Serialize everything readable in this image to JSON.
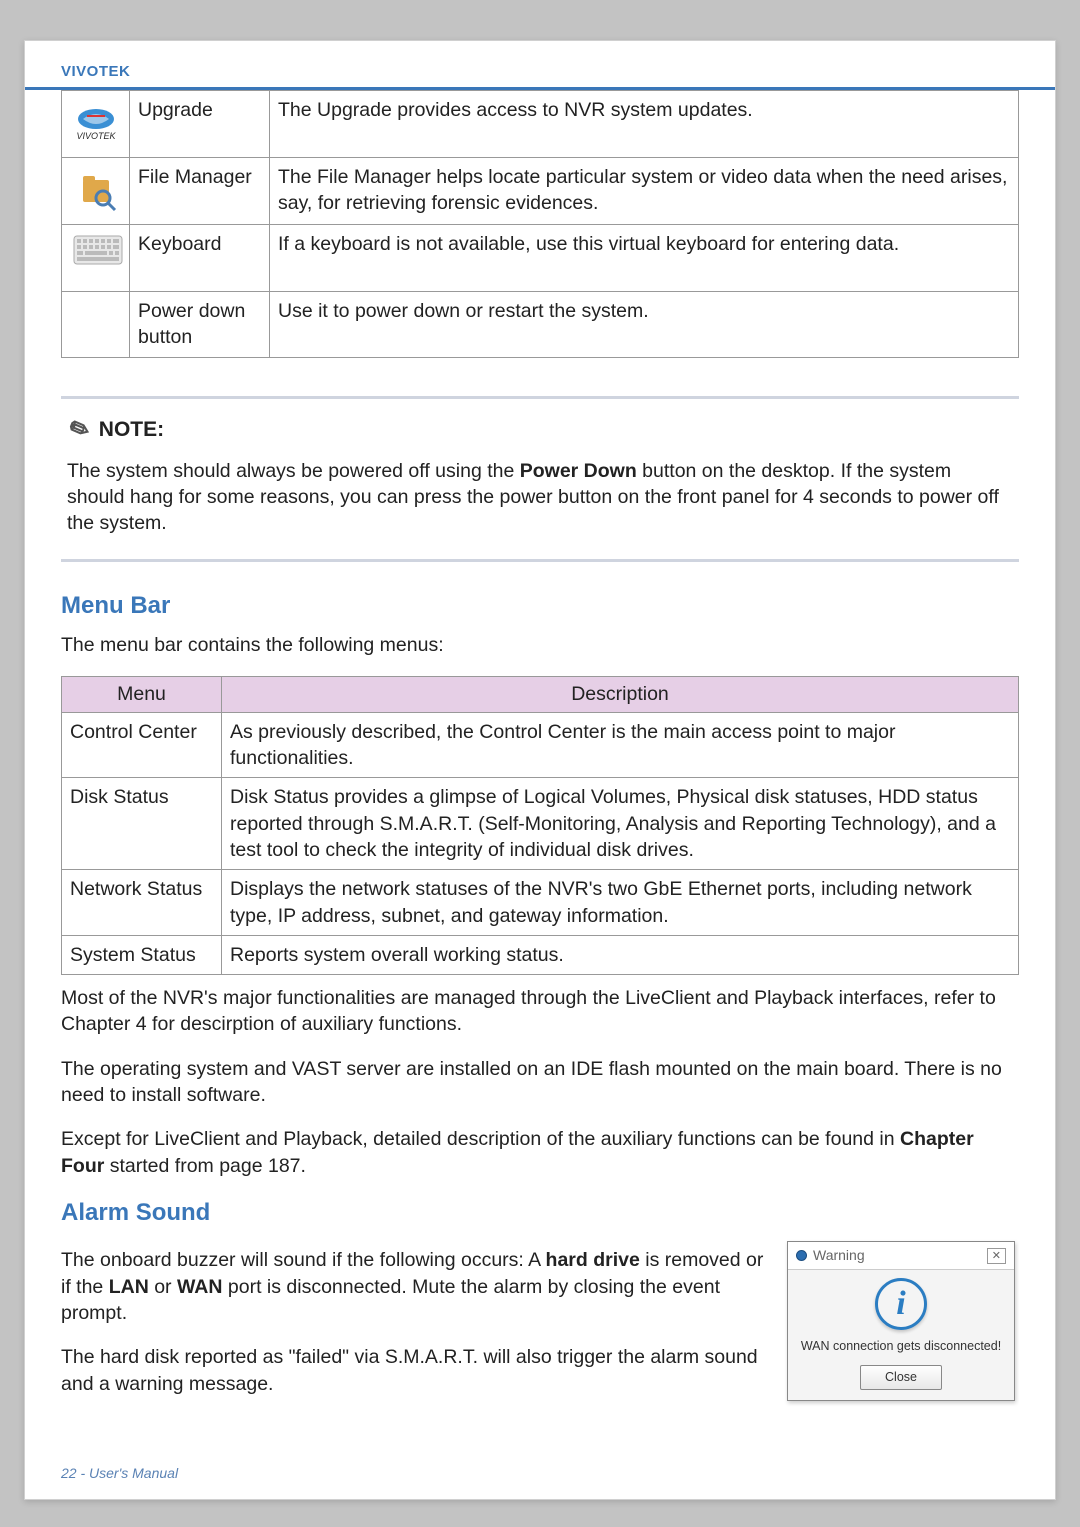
{
  "brand": "VIVOTEK",
  "items_table": {
    "rows": [
      {
        "icon": "upgrade",
        "name": "Upgrade",
        "desc": "The Upgrade provides access to NVR system updates."
      },
      {
        "icon": "file",
        "name": "File Manager",
        "desc": "The File Manager helps locate particular system or video data when the need arises, say, for retrieving forensic evidences."
      },
      {
        "icon": "keyboard",
        "name": "Keyboard",
        "desc": "If a keyboard is not available, use this virtual keyboard for entering data."
      },
      {
        "icon": "",
        "name": "Power down button",
        "desc": "Use it to power down or restart the system."
      }
    ]
  },
  "note": {
    "heading": "NOTE:",
    "p1a": "The system should always be powered off using the ",
    "p1b": "Power Down",
    "p1c": " button on the desktop. If the system should hang for some reasons, you can press the power button on the front panel for 4 seconds to power off the system."
  },
  "menubar": {
    "heading": "Menu Bar",
    "intro": "The menu bar contains the following menus:",
    "headers": {
      "c1": "Menu",
      "c2": "Description"
    },
    "rows": [
      {
        "menu": "Control Center",
        "desc": "As previously described, the Control Center is the main access point to major functionalities."
      },
      {
        "menu": "Disk Status",
        "desc": "Disk Status provides a glimpse of Logical Volumes, Physical disk statuses, HDD status reported through S.M.A.R.T. (Self-Monitoring, Analysis and Reporting Technology), and a test tool to check the integrity of individual disk drives."
      },
      {
        "menu": "Network Status",
        "desc": "Displays the network statuses of the NVR's two GbE Ethernet ports, including network type, IP address, subnet, and gateway information."
      },
      {
        "menu": "System Status",
        "desc": "Reports system overall working status."
      }
    ]
  },
  "paras": {
    "p1": "Most of the NVR's major functionalities are managed through the LiveClient and Playback interfaces, refer to Chapter 4 for descirption of auxiliary functions.",
    "p2": "The operating system and VAST server are installed on an IDE flash mounted on the main board. There is no need to install software.",
    "p3a": "Except for LiveClient and Playback, detailed description of the auxiliary functions can be found in ",
    "p3b": "Chapter Four",
    "p3c": " started from page 187."
  },
  "alarm": {
    "heading": "Alarm Sound",
    "p1a": "The onboard buzzer will sound if the following occurs: A ",
    "p1b": "hard drive",
    "p1c": " is removed or if the ",
    "p1d": "LAN",
    "p1e": " or ",
    "p1f": "WAN",
    "p1g": " port is disconnected. Mute the alarm by closing the event prompt.",
    "p2": "The hard disk reported as \"failed\" via S.M.A.R.T. will also trigger the alarm sound and a warning message."
  },
  "dialog": {
    "title": "Warning",
    "message": "WAN connection gets disconnected!",
    "close": "Close",
    "x": "✕"
  },
  "footer": "22 - User's Manual"
}
